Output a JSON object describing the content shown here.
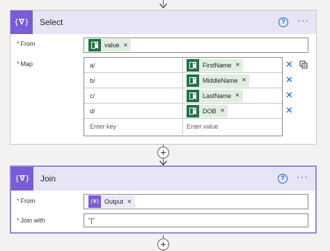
{
  "select": {
    "title": "Select",
    "icon": "{𝛁}",
    "help": "?",
    "more": "···",
    "from_label": "From",
    "from_token": "value",
    "map_label": "Map",
    "rows": [
      {
        "key": "a/",
        "value": "FirstName"
      },
      {
        "key": "b/",
        "value": "MiddleName"
      },
      {
        "key": "c/",
        "value": "LastName"
      },
      {
        "key": "d/",
        "value": "DOB"
      }
    ],
    "key_placeholder": "Enter key",
    "value_placeholder": "Enter value"
  },
  "join": {
    "title": "Join",
    "icon": "{𝛁}",
    "help": "?",
    "more": "···",
    "from_label": "From",
    "from_token": "Output",
    "joinwith_label": "Join with",
    "joinwith_value": "\"|\""
  },
  "colors": {
    "accent": "#7a5bd9",
    "link": "#0f6cbd",
    "excel": "#217346",
    "token_bg": "#dfeee0"
  }
}
